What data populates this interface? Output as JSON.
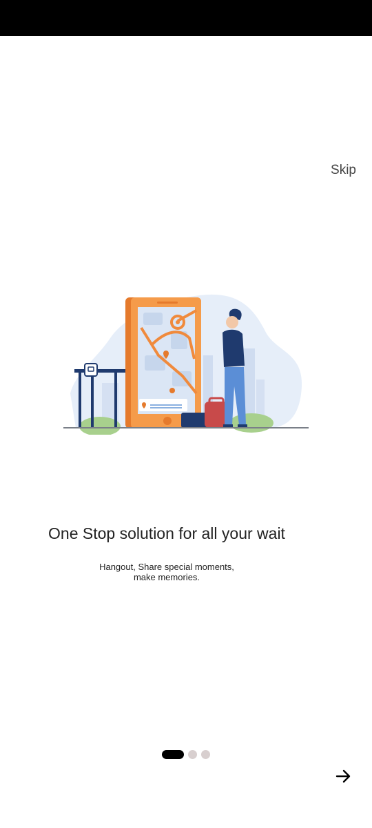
{
  "top_bar": {
    "skip_label": "Skip"
  },
  "illustration": {
    "icon": "map-navigation-illustration"
  },
  "content": {
    "headline": "One Stop solution for all your wait",
    "subtitle_line1": "Hangout, Share special moments,",
    "subtitle_line2": "make memories."
  },
  "pager": {
    "current_page": 1,
    "total_pages": 3
  },
  "navigation": {
    "next_icon": "arrow-right-icon"
  },
  "colors": {
    "accent_orange": "#f08a3c",
    "navy": "#1f3a6e",
    "light_blue": "#dde8f7"
  }
}
